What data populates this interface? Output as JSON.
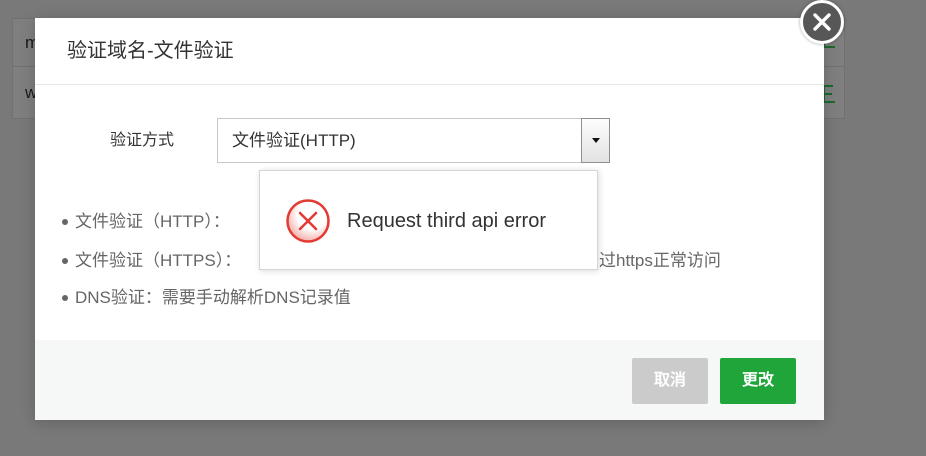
{
  "background_table": {
    "rows": [
      {
        "domain_text": "m"
      },
      {
        "domain_text": "w"
      }
    ]
  },
  "dialog": {
    "title": "验证域名-文件验证",
    "form": {
      "method_label": "验证方式",
      "method_select": {
        "selected": "文件验证(HTTP)"
      }
    },
    "notes": [
      {
        "text": "文件验证（HTTP）："
      },
      {
        "text": "文件验证（HTTPS）：",
        "trailing_text": "过https正常访问"
      },
      {
        "text": "DNS验证：需要手动解析DNS记录值"
      }
    ],
    "footer": {
      "cancel_label": "取消",
      "confirm_label": "更改"
    }
  },
  "toast": {
    "message": "Request third api error"
  },
  "icons": {
    "close": "close-icon",
    "dropdown": "caret-down-icon",
    "toast": "error-circle-icon",
    "bullet": "bullet-icon"
  },
  "colors": {
    "primary_green": "#20a53a",
    "cancel_gray": "#cbcbcb",
    "error_red": "#e33b34",
    "title_text": "#333333",
    "note_text": "#666666",
    "bg_link_green": "#36d058"
  }
}
